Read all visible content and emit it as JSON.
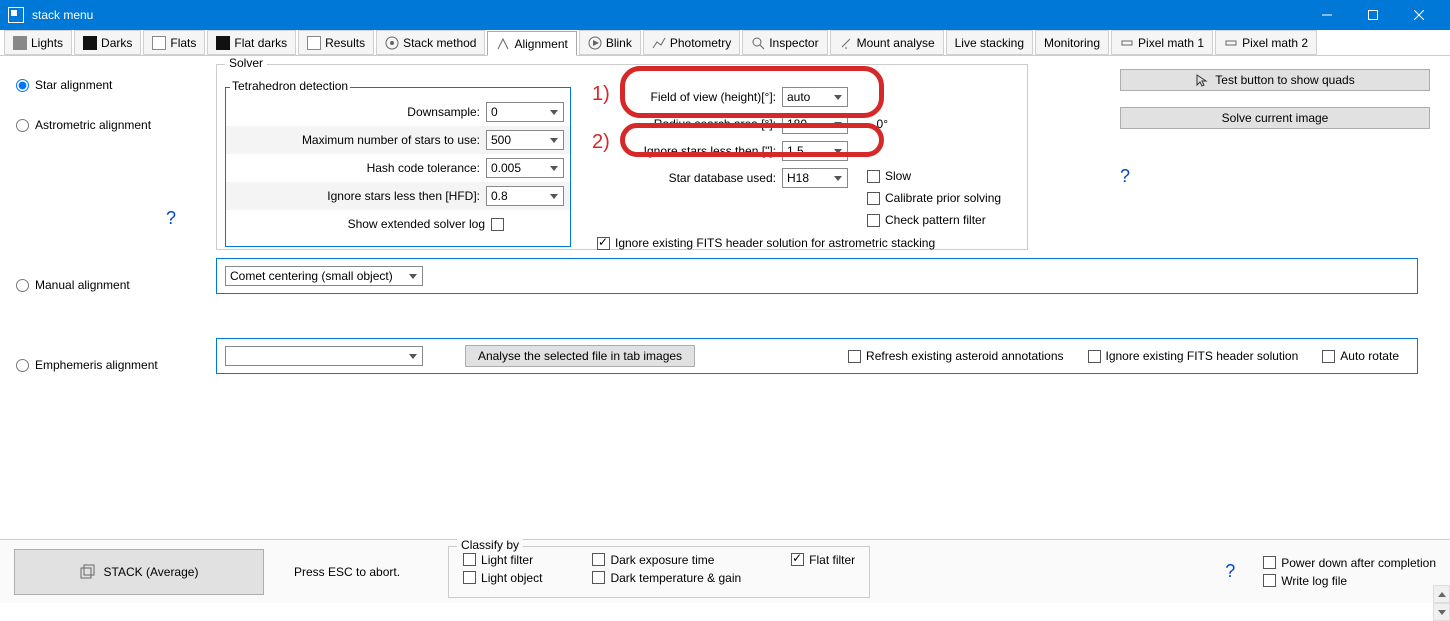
{
  "window": {
    "title": "stack menu"
  },
  "tabs": [
    "Lights",
    "Darks",
    "Flats",
    "Flat darks",
    "Results",
    "Stack method",
    "Alignment",
    "Blink",
    "Photometry",
    "Inspector",
    "Mount analyse",
    "Live stacking",
    "Monitoring",
    "Pixel math 1",
    "Pixel math 2"
  ],
  "radios": {
    "star": "Star alignment",
    "astro": "Astrometric alignment",
    "manual": "Manual alignment",
    "eph": "Emphemeris alignment"
  },
  "solver": {
    "legend": "Solver",
    "tetra_legend": "Tetrahedron detection",
    "downsample_label": "Downsample:",
    "downsample": "0",
    "maxstars_label": "Maximum number of stars to use:",
    "maxstars": "500",
    "hash_label": "Hash code tolerance:",
    "hash": "0.005",
    "ignorehfd_label": "Ignore stars less then [HFD]:",
    "ignorehfd": "0.8",
    "extended_label": "Show extended solver log",
    "fov_label": "Field of view (height)[°]:",
    "fov": "auto",
    "radius_label": "Radius search area  [°]:",
    "radius": "180",
    "radius_after": "0°",
    "ignorestars_label": "Ignore stars less then [\"]:",
    "ignorestars": "1.5",
    "stardb_label": "Star database used:",
    "stardb": "H18",
    "slow": "Slow",
    "calib": "Calibrate prior solving",
    "pattern": "Check pattern filter",
    "ignorefits": "Ignore existing FITS header solution for astrometric stacking"
  },
  "annot": {
    "one": "1)",
    "two": "2)"
  },
  "rightbuttons": {
    "test": "Test button to show quads",
    "solve": "Solve current image"
  },
  "manual": {
    "combo": "Comet centering (small object)"
  },
  "eph": {
    "analyse": "Analyse the selected file in tab images",
    "refresh": "Refresh existing asteroid annotations",
    "ignore": "Ignore existing FITS header solution",
    "autorot": "Auto rotate"
  },
  "bottom": {
    "stack": "STACK  (Average)",
    "esc": "Press ESC to abort.",
    "classify_legend": "Classify by",
    "lightfilter": "Light filter",
    "lightobject": "Light object",
    "darkexp": "Dark exposure time",
    "darktemp": "Dark temperature & gain",
    "flatfilter": "Flat filter",
    "power": "Power down after completion",
    "log": "Write log file"
  },
  "help": "?"
}
